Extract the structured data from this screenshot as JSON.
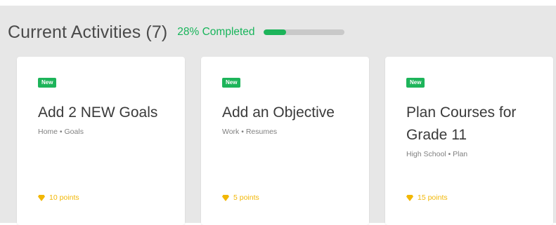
{
  "header": {
    "title": "Current Activities (7)",
    "completion_text": "28% Completed",
    "progress_fraction": 0.28
  },
  "colors": {
    "accent_green": "#1db45a",
    "points_gold": "#f2b705",
    "panel_bg": "#e7e7e7"
  },
  "cards": [
    {
      "badge": "New",
      "title": "Add 2 NEW Goals",
      "meta": "Home • Goals",
      "points": "10 points",
      "points_icon": "gem-icon"
    },
    {
      "badge": "New",
      "title": "Add an Objective",
      "meta": "Work • Resumes",
      "points": "5 points",
      "points_icon": "gem-icon"
    },
    {
      "badge": "New",
      "title": "Plan Courses for Grade 11",
      "meta": "High School • Plan",
      "points": "15 points",
      "points_icon": "gem-icon"
    }
  ]
}
